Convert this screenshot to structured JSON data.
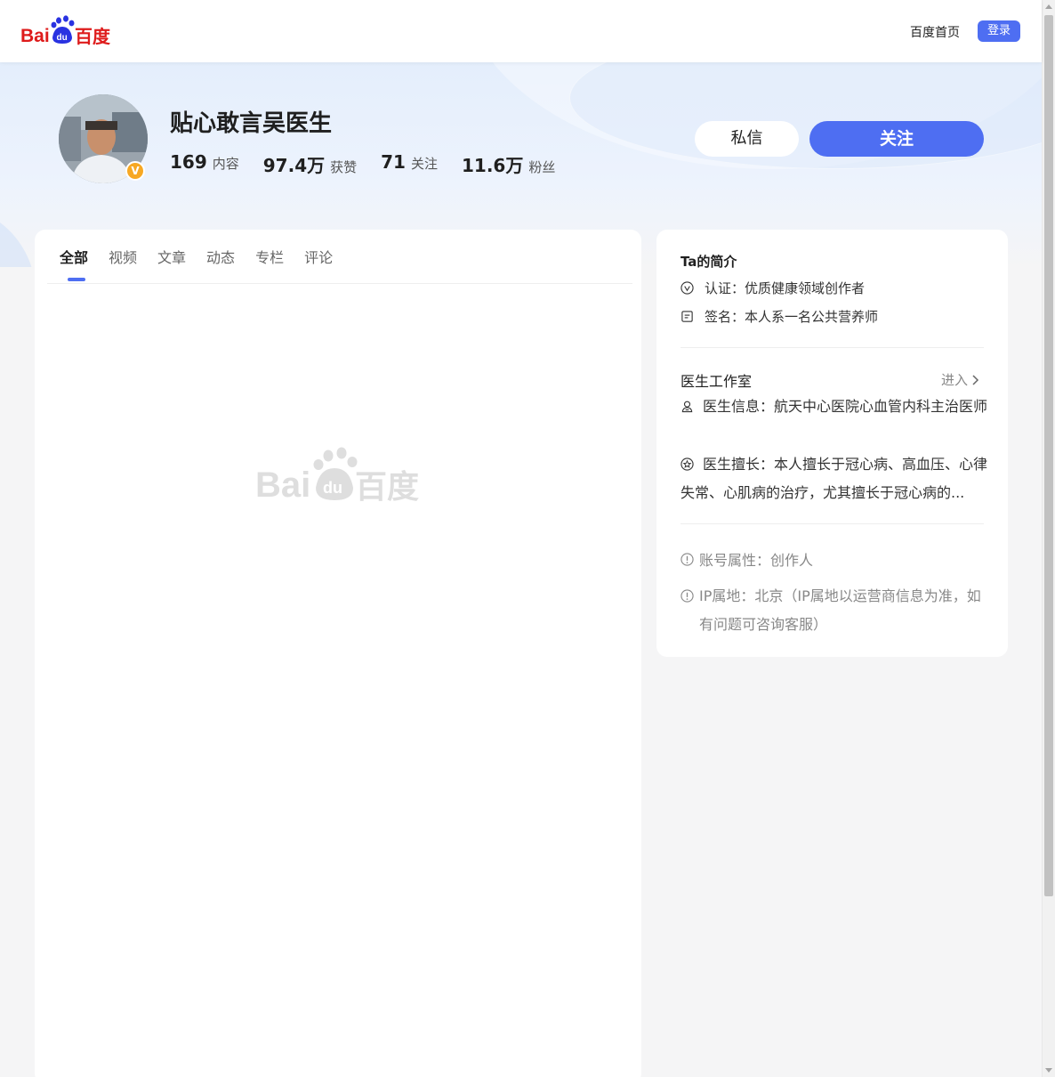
{
  "header": {
    "logo_text": "Bai du 百度",
    "home_link": "百度首页",
    "login_button": "登录"
  },
  "profile": {
    "name": "贴心敢言吴医生",
    "verified_badge": "V",
    "stats": [
      {
        "value": "169",
        "label": "内容"
      },
      {
        "value": "97.4万",
        "label": "获赞"
      },
      {
        "value": "71",
        "label": "关注"
      },
      {
        "value": "11.6万",
        "label": "粉丝"
      }
    ],
    "message_button": "私信",
    "follow_button": "关注"
  },
  "tabs": [
    {
      "label": "全部",
      "active": true
    },
    {
      "label": "视频",
      "active": false
    },
    {
      "label": "文章",
      "active": false
    },
    {
      "label": "动态",
      "active": false
    },
    {
      "label": "专栏",
      "active": false
    },
    {
      "label": "评论",
      "active": false
    }
  ],
  "sidebar": {
    "title": "Ta的简介",
    "certification": "认证：优质健康领域创作者",
    "signature": "签名：本人系一名公共营养师",
    "studio_title": "医生工作室",
    "enter_label": "进入",
    "doctor_info": "医生信息：航天中心医院心血管内科主治医师",
    "doctor_specialty": "医生擅长：本人擅长于冠心病、高血压、心律失常、心肌病的治疗，尤其擅长于冠心病的...",
    "account_type": "账号属性：创作人",
    "ip_location": "IP属地：北京（IP属地以运营商信息为准，如有问题可咨询客服）"
  },
  "colors": {
    "brand_blue": "#4e6ef2",
    "baidu_red": "#de1b1b",
    "badge_orange": "#f7a823"
  },
  "icons": [
    "baidu-logo",
    "verified-icon",
    "check-circle-icon",
    "document-icon",
    "chevron-right-icon",
    "doctor-icon",
    "star-circle-icon",
    "info-circle-icon"
  ]
}
